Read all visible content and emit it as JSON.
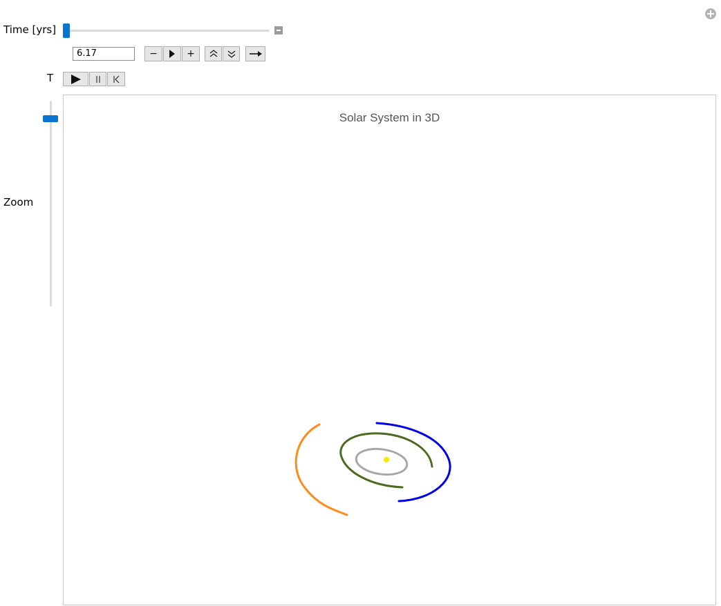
{
  "controls": {
    "time_label": "Time [yrs]",
    "time_value": "6.17",
    "time_slider_fraction": 0.0,
    "zoom_label": "Zoom",
    "zoom_slider_fraction": 0.08,
    "t_label": "T",
    "buttons": {
      "minus": "−",
      "play_forward": "▶",
      "plus": "+",
      "faster": "⌃⌃",
      "slower": "⌄⌄",
      "direction": "→",
      "play": "▶",
      "pause": "||",
      "reset": "|◁"
    }
  },
  "plot": {
    "title": "Solar System in 3D",
    "colors": {
      "sun": "#ffe600",
      "mercury_orbit": "#a7a7a7",
      "venus_orbit": "#4b6b1e",
      "earth_orbit": "#0000e6",
      "mars_orbit": "#ff8c1a",
      "frame": "#c8c8c8"
    }
  }
}
